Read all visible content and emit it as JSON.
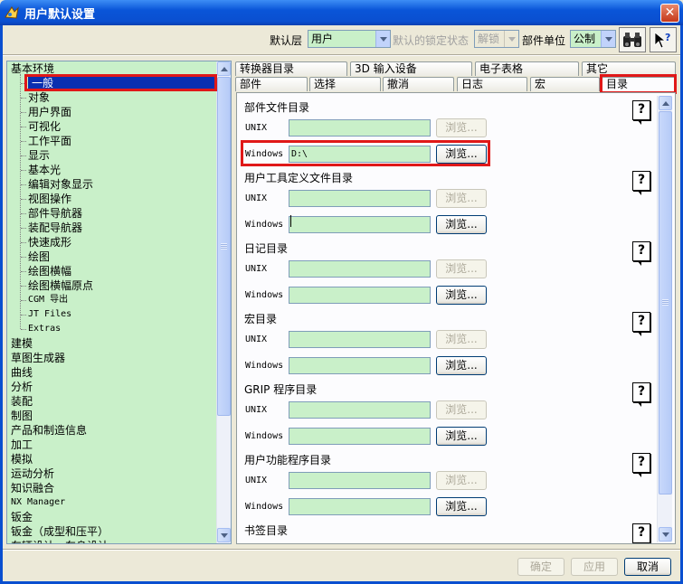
{
  "window": {
    "title": "用户默认设置",
    "close_glyph": "✕"
  },
  "toolbar": {
    "level_label": "默认层",
    "level_value": "用户",
    "lock_label": "默认的锁定状态",
    "lock_value": "解锁",
    "unit_label": "部件单位",
    "unit_value": "公制",
    "find_icon": "binoculars-icon",
    "whatsthis_icon": "whats-this-help-icon"
  },
  "tree": {
    "items": [
      {
        "label": "基本环境",
        "level": 0
      },
      {
        "label": "一般",
        "level": 1,
        "selected": true
      },
      {
        "label": "对象",
        "level": 1
      },
      {
        "label": "用户界面",
        "level": 1
      },
      {
        "label": "可视化",
        "level": 1
      },
      {
        "label": "工作平面",
        "level": 1
      },
      {
        "label": "显示",
        "level": 1
      },
      {
        "label": "基本光",
        "level": 1
      },
      {
        "label": "编辑对象显示",
        "level": 1
      },
      {
        "label": "视图操作",
        "level": 1
      },
      {
        "label": "部件导航器",
        "level": 1
      },
      {
        "label": "装配导航器",
        "level": 1
      },
      {
        "label": "快速成形",
        "level": 1
      },
      {
        "label": "绘图",
        "level": 1
      },
      {
        "label": "绘图横幅",
        "level": 1
      },
      {
        "label": "绘图横幅原点",
        "level": 1
      },
      {
        "label": "CGM 导出",
        "level": 1,
        "mono": true
      },
      {
        "label": "JT Files",
        "level": 1,
        "mono": true
      },
      {
        "label": "Extras",
        "level": 1,
        "mono": true
      },
      {
        "label": "建模",
        "level": 0
      },
      {
        "label": "草图生成器",
        "level": 0
      },
      {
        "label": "曲线",
        "level": 0
      },
      {
        "label": "分析",
        "level": 0
      },
      {
        "label": "装配",
        "level": 0
      },
      {
        "label": "制图",
        "level": 0
      },
      {
        "label": "产品和制造信息",
        "level": 0
      },
      {
        "label": "加工",
        "level": 0
      },
      {
        "label": "模拟",
        "level": 0
      },
      {
        "label": "运动分析",
        "level": 0
      },
      {
        "label": "知识融合",
        "level": 0
      },
      {
        "label": "NX Manager",
        "level": 0,
        "mono": true
      },
      {
        "label": "钣金",
        "level": 0
      },
      {
        "label": "钣金（成型和压平）",
        "level": 0
      },
      {
        "label": "车辆设计 - 车身设计",
        "level": 0
      }
    ]
  },
  "tabs": {
    "row1": [
      "转换器目录",
      "3D 输入设备",
      "电子表格",
      "其它"
    ],
    "row2": [
      "部件",
      "选择",
      "撤消",
      "日志",
      "宏",
      "目录"
    ],
    "active": "目录"
  },
  "sections": [
    {
      "title": "部件文件目录",
      "rows": [
        {
          "label": "UNIX",
          "value": "",
          "browse_enabled": false
        },
        {
          "label": "Windows",
          "value": "D:\\",
          "browse_enabled": true
        }
      ]
    },
    {
      "title": "用户工具定义文件目录",
      "rows": [
        {
          "label": "UNIX",
          "value": "",
          "browse_enabled": false
        },
        {
          "label": "Windows",
          "value": "",
          "browse_enabled": true
        }
      ]
    },
    {
      "title": "日记目录",
      "rows": [
        {
          "label": "UNIX",
          "value": "",
          "browse_enabled": false
        },
        {
          "label": "Windows",
          "value": "",
          "browse_enabled": true
        }
      ]
    },
    {
      "title": "宏目录",
      "rows": [
        {
          "label": "UNIX",
          "value": "",
          "browse_enabled": false
        },
        {
          "label": "Windows",
          "value": "",
          "browse_enabled": true
        }
      ]
    },
    {
      "title": "GRIP 程序目录",
      "rows": [
        {
          "label": "UNIX",
          "value": "",
          "browse_enabled": false
        },
        {
          "label": "Windows",
          "value": "",
          "browse_enabled": true
        }
      ]
    },
    {
      "title": "用户功能程序目录",
      "rows": [
        {
          "label": "UNIX",
          "value": "",
          "browse_enabled": false
        },
        {
          "label": "Windows",
          "value": "",
          "browse_enabled": true
        }
      ]
    },
    {
      "title": "书签目录",
      "rows": []
    }
  ],
  "browse_label": "浏览...",
  "help_glyph": "?",
  "buttons": {
    "ok": "确定",
    "apply": "应用",
    "cancel": "取消"
  }
}
